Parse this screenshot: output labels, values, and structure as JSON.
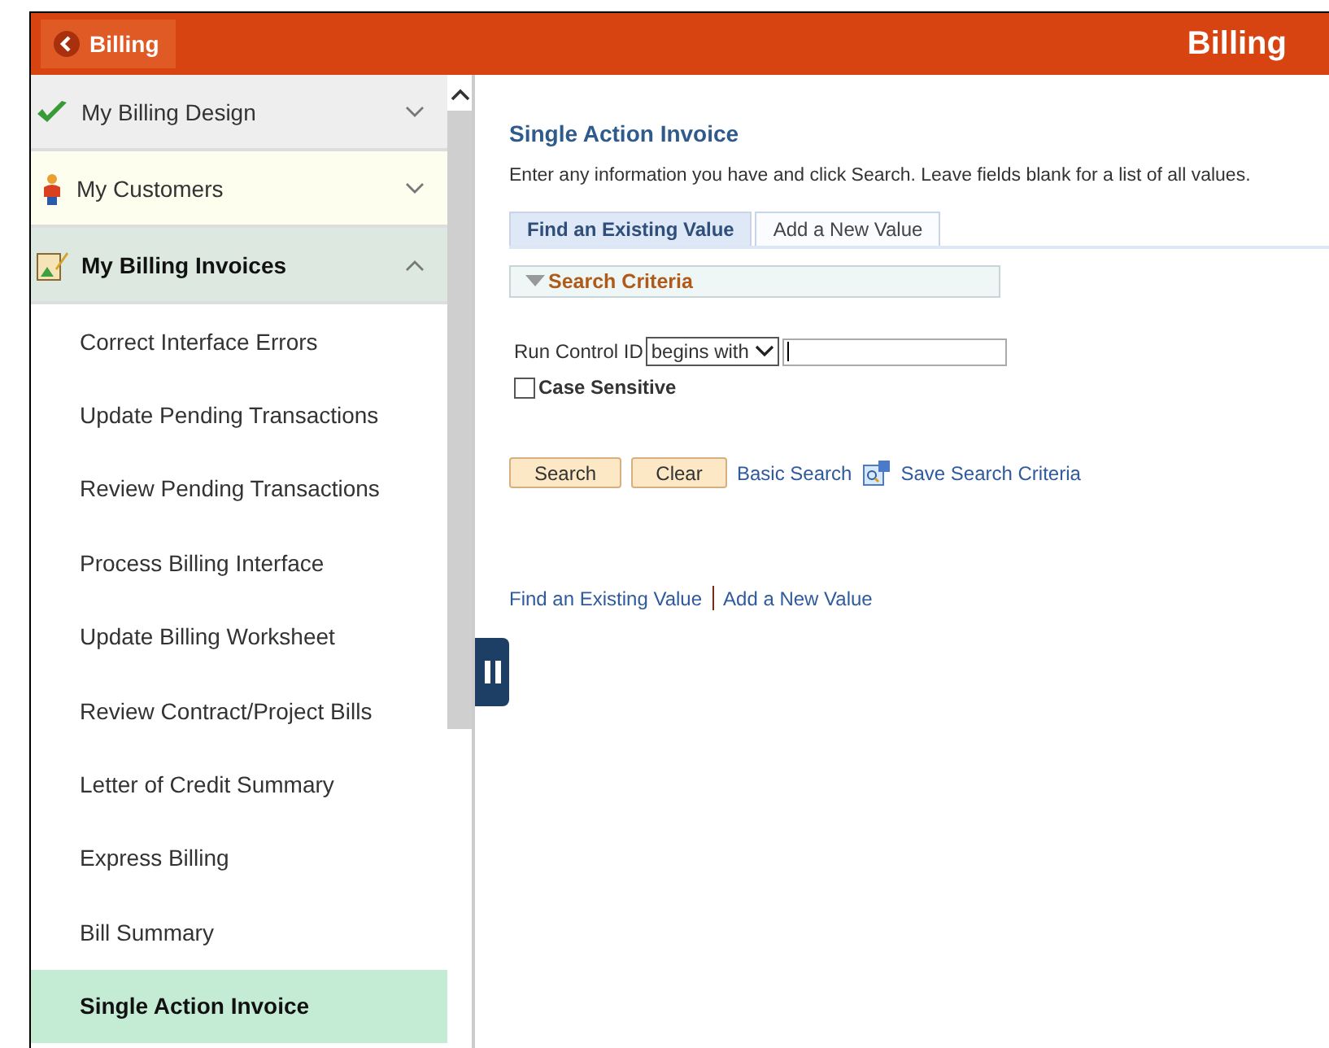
{
  "header": {
    "back_button": "Billing",
    "title": "Billing"
  },
  "sidebar": {
    "groups": [
      {
        "kind": "check",
        "label": "My Billing Design",
        "expanded": false
      },
      {
        "kind": "person",
        "label": "My Customers",
        "expanded": false
      },
      {
        "kind": "clipboard",
        "label": "My Billing Invoices",
        "expanded": true,
        "items": [
          {
            "label": "Correct Interface Errors",
            "selected": false
          },
          {
            "label": "Update Pending Transactions",
            "selected": false
          },
          {
            "label": "Review Pending Transactions",
            "selected": false
          },
          {
            "label": "Process Billing Interface",
            "selected": false
          },
          {
            "label": "Update Billing Worksheet",
            "selected": false
          },
          {
            "label": "Review Contract/Project Bills",
            "selected": false
          },
          {
            "label": "Letter of Credit Summary",
            "selected": false
          },
          {
            "label": "Express Billing",
            "selected": false
          },
          {
            "label": "Bill Summary",
            "selected": false
          },
          {
            "label": "Single Action Invoice",
            "selected": true
          }
        ]
      }
    ]
  },
  "content": {
    "title": "Single Action Invoice",
    "instructions": "Enter any information you have and click Search. Leave fields blank for a list of all values.",
    "tabs": [
      {
        "label": "Find an Existing Value",
        "selected": true
      },
      {
        "label": "Add a New Value",
        "selected": false
      }
    ],
    "section": "Search Criteria",
    "field": {
      "label": "Run Control ID",
      "operator": "begins with"
    },
    "case_sensitive": {
      "label": "Case Sensitive",
      "checked": false
    },
    "buttons": [
      "Search",
      "Clear"
    ],
    "links": [
      "Basic Search",
      "Save Search Criteria"
    ],
    "bottom_links": [
      "Find an Existing Value",
      "Add a New Value"
    ]
  }
}
